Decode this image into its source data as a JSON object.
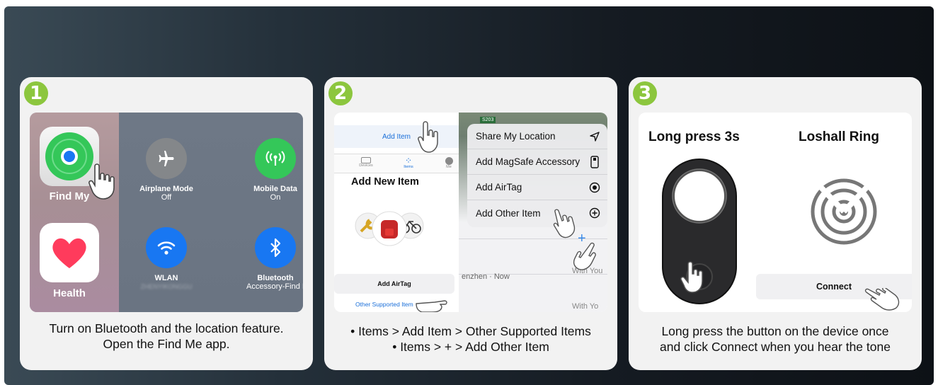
{
  "steps": [
    {
      "number": "1",
      "screen": {
        "findmy_label": "Find My",
        "health_label": "Health",
        "airplane": {
          "label": "Airplane Mode",
          "state": "Off"
        },
        "mobile": {
          "label": "Mobile Data",
          "state": "On"
        },
        "wlan": {
          "label": "WLAN",
          "state": "ZHENYIKONGGU"
        },
        "bluetooth": {
          "label": "Bluetooth",
          "state": "Accessory-Find I"
        }
      },
      "caption": [
        "Turn on Bluetooth and the location feature.",
        "Open the Find Me app."
      ]
    },
    {
      "number": "2",
      "screen": {
        "add_item": "Add Item",
        "tabs": [
          "Devices",
          "Items",
          "Me"
        ],
        "add_new_item": "Add New Item",
        "add_airtag": "Add AirTag",
        "other_supported": "Other Supported Item",
        "menu": [
          "Share My Location",
          "Add MagSafe Accessory",
          "Add AirTag",
          "Add Other Item"
        ],
        "map_label": "S203",
        "location_row": "enzhen · Now",
        "with_you_1": "With You",
        "with_you_2": "With Yo"
      },
      "caption": [
        "• Items > Add Item > Other Supported Items",
        "• Items > + > Add Other Item"
      ]
    },
    {
      "number": "3",
      "screen": {
        "left_title": "Long press 3s",
        "right_title": "Loshall Ring",
        "connect": "Connect"
      },
      "caption": [
        "Long press the button on the device once",
        "and click Connect when you hear the tone"
      ]
    }
  ],
  "colors": {
    "badge": "#8cc63e",
    "findmy_green": "#34c759",
    "ios_blue": "#1877f2",
    "heart_red": "#ff3b5c",
    "ios_link": "#1a6fd9"
  }
}
